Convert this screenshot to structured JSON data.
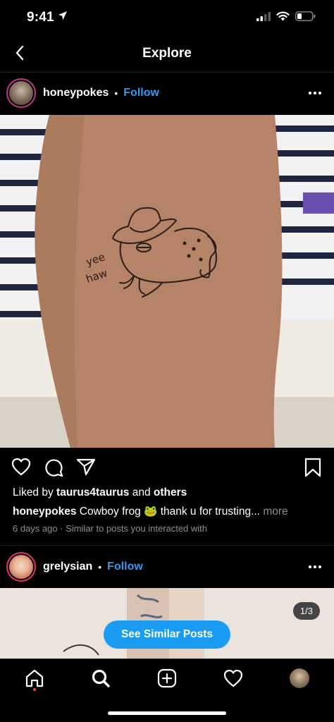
{
  "status_bar": {
    "time": "9:41"
  },
  "header": {
    "title": "Explore"
  },
  "post1": {
    "username": "honeypokes",
    "follow_label": "Follow",
    "liked_by_prefix": "Liked by",
    "liked_by_user": "taurus4taurus",
    "liked_by_and": "and",
    "liked_by_others": "others",
    "caption_user": "honeypokes",
    "caption_text": "Cowboy frog 🐸  thank u for trusting...",
    "caption_more": "more",
    "meta": "6 days ago · Similar to posts you interacted with",
    "tattoo_text_line1": "yee",
    "tattoo_text_line2": "haw"
  },
  "post2": {
    "username": "grelysian",
    "follow_label": "Follow",
    "counter": "1/3"
  },
  "similar_button": "See Similar Posts",
  "colors": {
    "accent": "#3797f0",
    "button": "#1a9cf2",
    "notification": "#ed4956"
  },
  "icons": {
    "tab_bar": [
      "home-icon",
      "search-icon",
      "new-post-icon",
      "activity-heart-icon",
      "profile-avatar"
    ],
    "actions": [
      "like-heart-icon",
      "comment-icon",
      "share-icon",
      "save-bookmark-icon"
    ]
  }
}
